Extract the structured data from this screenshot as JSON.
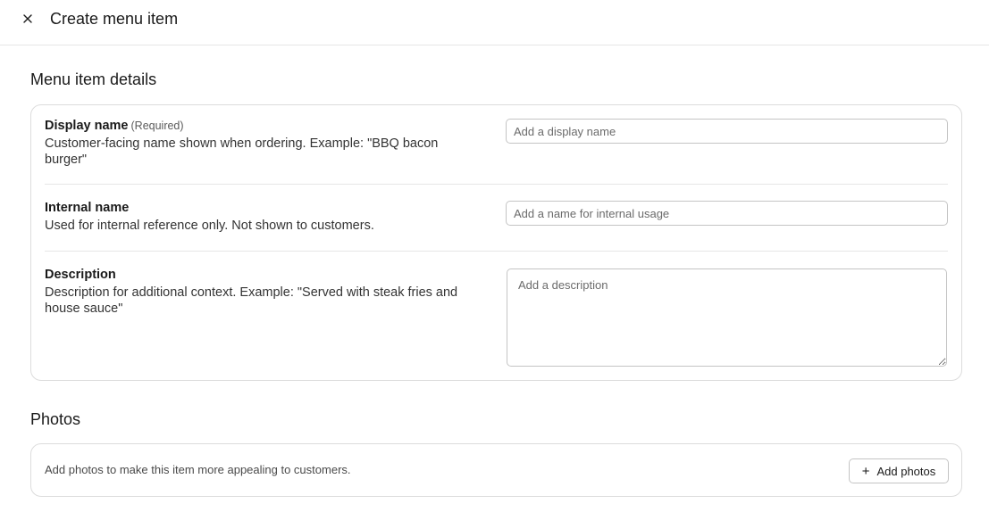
{
  "header": {
    "title": "Create menu item",
    "close_icon": "close-icon"
  },
  "details": {
    "heading": "Menu item details",
    "display_name": {
      "label": "Display name",
      "required_tag": "(Required)",
      "help": "Customer-facing name shown when ordering. Example: \"BBQ bacon burger\"",
      "value": "",
      "placeholder": "Add a display name"
    },
    "internal_name": {
      "label": "Internal name",
      "help": "Used for internal reference only. Not shown to customers.",
      "value": "",
      "placeholder": "Add a name for internal usage"
    },
    "description": {
      "label": "Description",
      "help": "Description for additional context. Example: \"Served with steak fries and house sauce\"",
      "value": "",
      "placeholder": "Add a description"
    }
  },
  "photos": {
    "heading": "Photos",
    "help": "Add photos to make this item more appealing to customers.",
    "add_button_label": "Add photos",
    "add_button_icon": "plus-icon"
  }
}
